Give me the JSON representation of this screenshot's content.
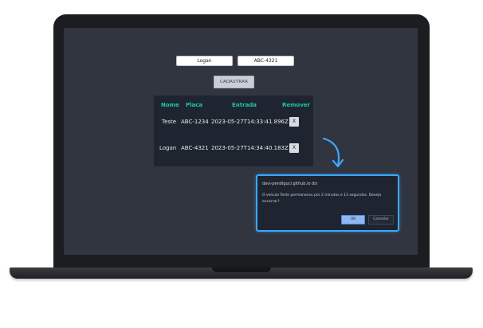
{
  "form": {
    "name_value": "Logan",
    "plate_value": "ABC-4321",
    "submit_label": "CADASTRAR"
  },
  "table": {
    "headers": [
      "Nome",
      "Placa",
      "Entrada",
      "Remover"
    ],
    "rows": [
      {
        "nome": "Teste",
        "placa": "ABC-1234",
        "entrada": "2023-05-27T14:33:41.896Z",
        "remove_label": "X"
      },
      {
        "nome": "Logan",
        "placa": "ABC-4321",
        "entrada": "2023-05-27T14:34:40.183Z",
        "remove_label": "X"
      }
    ]
  },
  "dialog": {
    "title": "davi-pendiguci.github.io diz",
    "message": "O veículo Teste permaneceu por 2 minutos e 13 segundos. Deseja encerrar?",
    "ok_label": "OK",
    "cancel_label": "Cancelar"
  },
  "colors": {
    "accent": "#1fc7a6",
    "dialog_border": "#3aa9ff",
    "screen_bg": "#313540"
  }
}
